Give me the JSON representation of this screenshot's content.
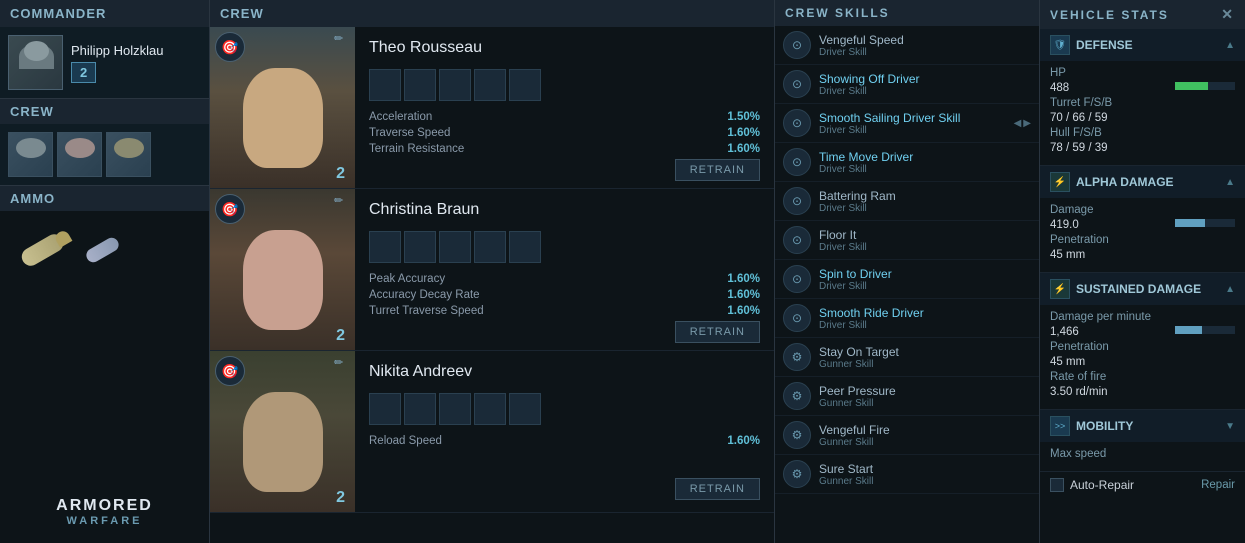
{
  "commander": {
    "section_label": "Commander",
    "name": "Philipp Holzklau",
    "level": "2"
  },
  "crew": {
    "section_label": "Crew",
    "members": [
      {
        "name": "Theo Rousseau",
        "level": "2",
        "role_icon": "🎯",
        "stats": [
          {
            "label": "Acceleration",
            "value": "1.50%"
          },
          {
            "label": "Traverse Speed",
            "value": "1.60%"
          },
          {
            "label": "Terrain Resistance",
            "value": "1.60%"
          }
        ],
        "retrain_label": "RETRAIN"
      },
      {
        "name": "Christina Braun",
        "level": "2",
        "role_icon": "🎯",
        "stats": [
          {
            "label": "Peak Accuracy",
            "value": "1.60%"
          },
          {
            "label": "Accuracy Decay Rate",
            "value": "1.60%"
          },
          {
            "label": "Turret Traverse Speed",
            "value": "1.60%"
          }
        ],
        "retrain_label": "RETRAIN"
      },
      {
        "name": "Nikita Andreev",
        "level": "2",
        "role_icon": "🎯",
        "stats": [
          {
            "label": "Reload Speed",
            "value": "1.60%"
          }
        ],
        "retrain_label": "RETRAIN"
      }
    ]
  },
  "ammo": {
    "section_label": "Ammo"
  },
  "crew_skills": {
    "section_label": "CREW SKILLS",
    "skills": [
      {
        "name": "Vengeful Speed",
        "sub": "Driver Skill",
        "active": false
      },
      {
        "name": "Showing Off Driver",
        "sub": "Driver Skill",
        "active": false
      },
      {
        "name": "Smooth Sailing Driver Skill",
        "sub": "Driver Skill",
        "active": false
      },
      {
        "name": "Time Move Driver",
        "sub": "Driver Skill",
        "active": false
      },
      {
        "name": "Battering Ram",
        "sub": "Driver Skill",
        "active": false
      },
      {
        "name": "Floor It",
        "sub": "Driver Skill",
        "active": false
      },
      {
        "name": "Spin to Driver",
        "sub": "Driver Skill",
        "active": false
      },
      {
        "name": "Smooth Ride Driver",
        "sub": "Driver Skill",
        "active": false
      },
      {
        "name": "Stay On Target",
        "sub": "Gunner Skill",
        "active": false
      },
      {
        "name": "Peer Pressure",
        "sub": "Gunner Skill",
        "active": false
      },
      {
        "name": "Vengeful Fire",
        "sub": "Gunner Skill",
        "active": false
      },
      {
        "name": "Sure Start",
        "sub": "Gunner Skill",
        "active": false
      }
    ]
  },
  "vehicle_stats": {
    "section_label": "VEHICLE STATS",
    "close_label": "✕",
    "sections": [
      {
        "title": "Defense",
        "icon": "🛡",
        "entries": [
          {
            "label": "HP",
            "value": ""
          },
          {
            "label": "488",
            "value": ""
          },
          {
            "label": "Turret F/S/B",
            "value": ""
          },
          {
            "label": "70 / 66 / 59",
            "value": ""
          },
          {
            "label": "Hull F/S/B",
            "value": ""
          },
          {
            "label": "78 / 59 / 39",
            "value": ""
          }
        ]
      },
      {
        "title": "Alpha Damage",
        "icon": "⚡",
        "entries": [
          {
            "label": "Damage",
            "value": ""
          },
          {
            "label": "419.0",
            "value": ""
          },
          {
            "label": "Penetration",
            "value": ""
          },
          {
            "label": "45 mm",
            "value": ""
          }
        ]
      },
      {
        "title": "Sustained Damage",
        "icon": "⚡",
        "entries": [
          {
            "label": "Damage per minute",
            "value": ""
          },
          {
            "label": "1,466",
            "value": ""
          },
          {
            "label": "Penetration",
            "value": ""
          },
          {
            "label": "45 mm",
            "value": ""
          },
          {
            "label": "Rate of fire",
            "value": ""
          },
          {
            "label": "3.50 rd/min",
            "value": ""
          }
        ]
      },
      {
        "title": "Mobility",
        "icon": ">>",
        "entries": [
          {
            "label": "Max speed",
            "value": ""
          }
        ]
      }
    ],
    "auto_repair_label": "Auto-Repair",
    "repair_label": "Repair"
  },
  "logo": {
    "line1": "ARMORED",
    "line2": "WARFARE"
  }
}
